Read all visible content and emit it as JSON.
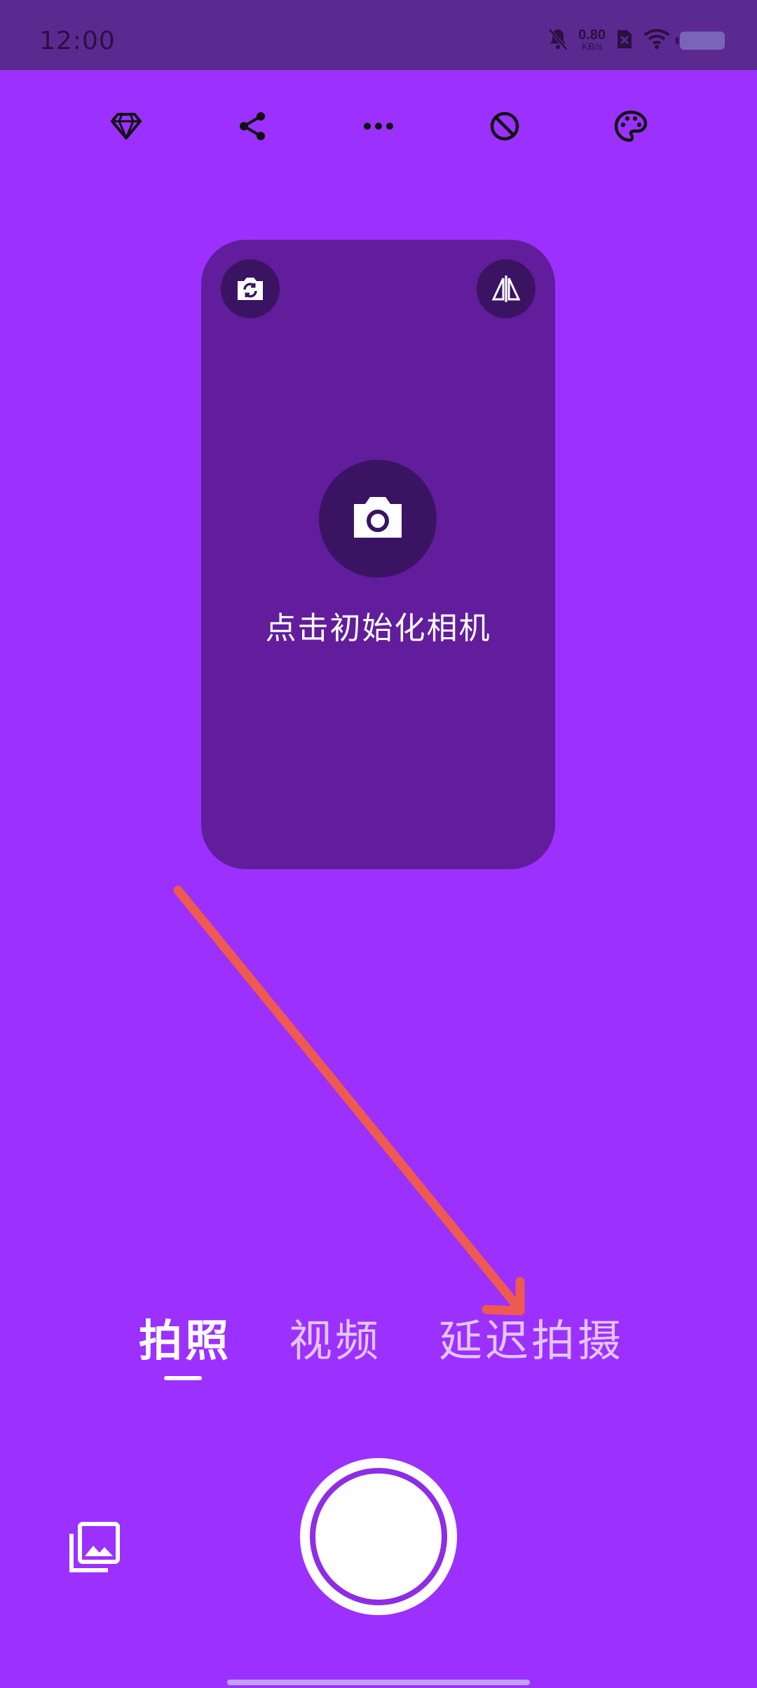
{
  "status_bar": {
    "time": "12:00",
    "net_speed_value": "0.80",
    "net_speed_unit": "KB/s",
    "icons": [
      "bell-muted-icon",
      "sim-off-icon",
      "wifi-icon",
      "battery-icon"
    ]
  },
  "toolbar": {
    "icons": [
      "diamond-icon",
      "share-icon",
      "more-icon",
      "flash-off-icon",
      "palette-icon"
    ]
  },
  "preview": {
    "init_text": "点击初始化相机",
    "icons": [
      "switch-camera-icon",
      "mirror-icon",
      "camera-icon"
    ]
  },
  "modes": {
    "items": [
      {
        "label": "拍照",
        "active": true
      },
      {
        "label": "视频",
        "active": false
      },
      {
        "label": "延迟拍摄",
        "active": false
      }
    ]
  },
  "colors": {
    "background": "#9b30ff",
    "status_bar": "#5a2a90",
    "preview_card": "#611d9c",
    "annotation_arrow": "#ee5a4f"
  },
  "bottom": {
    "icons": [
      "gallery-icon",
      "shutter-button"
    ]
  }
}
